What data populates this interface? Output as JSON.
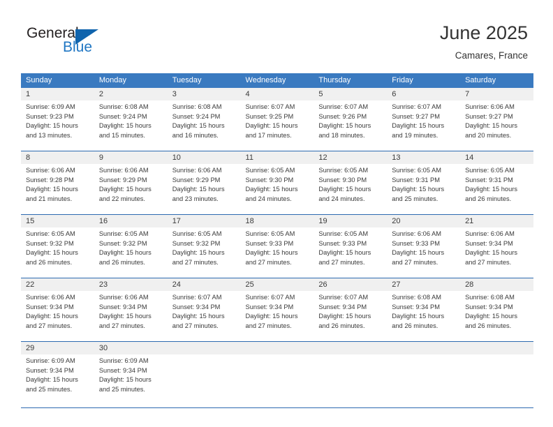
{
  "logo": {
    "word_top": "General",
    "word_bottom": "Blue",
    "triangle_icon": "triangle-icon",
    "brand_color": "#1f76c3",
    "triangle_color": "#1064ad"
  },
  "header": {
    "title": "June 2025",
    "subtitle": "Camares, France"
  },
  "theme": {
    "header_row_bg": "#3a7ac0",
    "header_row_text": "#ffffff",
    "week_divider": "#2d6ab0",
    "day_number_band_bg": "#f0f0f0",
    "text": "#3a3a3a"
  },
  "calendar": {
    "day_headers": [
      "Sunday",
      "Monday",
      "Tuesday",
      "Wednesday",
      "Thursday",
      "Friday",
      "Saturday"
    ],
    "weeks": [
      {
        "days": [
          {
            "num": "1",
            "sunrise": "Sunrise: 6:09 AM",
            "sunset": "Sunset: 9:23 PM",
            "daylight1": "Daylight: 15 hours",
            "daylight2": "and 13 minutes."
          },
          {
            "num": "2",
            "sunrise": "Sunrise: 6:08 AM",
            "sunset": "Sunset: 9:24 PM",
            "daylight1": "Daylight: 15 hours",
            "daylight2": "and 15 minutes."
          },
          {
            "num": "3",
            "sunrise": "Sunrise: 6:08 AM",
            "sunset": "Sunset: 9:24 PM",
            "daylight1": "Daylight: 15 hours",
            "daylight2": "and 16 minutes."
          },
          {
            "num": "4",
            "sunrise": "Sunrise: 6:07 AM",
            "sunset": "Sunset: 9:25 PM",
            "daylight1": "Daylight: 15 hours",
            "daylight2": "and 17 minutes."
          },
          {
            "num": "5",
            "sunrise": "Sunrise: 6:07 AM",
            "sunset": "Sunset: 9:26 PM",
            "daylight1": "Daylight: 15 hours",
            "daylight2": "and 18 minutes."
          },
          {
            "num": "6",
            "sunrise": "Sunrise: 6:07 AM",
            "sunset": "Sunset: 9:27 PM",
            "daylight1": "Daylight: 15 hours",
            "daylight2": "and 19 minutes."
          },
          {
            "num": "7",
            "sunrise": "Sunrise: 6:06 AM",
            "sunset": "Sunset: 9:27 PM",
            "daylight1": "Daylight: 15 hours",
            "daylight2": "and 20 minutes."
          }
        ]
      },
      {
        "days": [
          {
            "num": "8",
            "sunrise": "Sunrise: 6:06 AM",
            "sunset": "Sunset: 9:28 PM",
            "daylight1": "Daylight: 15 hours",
            "daylight2": "and 21 minutes."
          },
          {
            "num": "9",
            "sunrise": "Sunrise: 6:06 AM",
            "sunset": "Sunset: 9:29 PM",
            "daylight1": "Daylight: 15 hours",
            "daylight2": "and 22 minutes."
          },
          {
            "num": "10",
            "sunrise": "Sunrise: 6:06 AM",
            "sunset": "Sunset: 9:29 PM",
            "daylight1": "Daylight: 15 hours",
            "daylight2": "and 23 minutes."
          },
          {
            "num": "11",
            "sunrise": "Sunrise: 6:05 AM",
            "sunset": "Sunset: 9:30 PM",
            "daylight1": "Daylight: 15 hours",
            "daylight2": "and 24 minutes."
          },
          {
            "num": "12",
            "sunrise": "Sunrise: 6:05 AM",
            "sunset": "Sunset: 9:30 PM",
            "daylight1": "Daylight: 15 hours",
            "daylight2": "and 24 minutes."
          },
          {
            "num": "13",
            "sunrise": "Sunrise: 6:05 AM",
            "sunset": "Sunset: 9:31 PM",
            "daylight1": "Daylight: 15 hours",
            "daylight2": "and 25 minutes."
          },
          {
            "num": "14",
            "sunrise": "Sunrise: 6:05 AM",
            "sunset": "Sunset: 9:31 PM",
            "daylight1": "Daylight: 15 hours",
            "daylight2": "and 26 minutes."
          }
        ]
      },
      {
        "days": [
          {
            "num": "15",
            "sunrise": "Sunrise: 6:05 AM",
            "sunset": "Sunset: 9:32 PM",
            "daylight1": "Daylight: 15 hours",
            "daylight2": "and 26 minutes."
          },
          {
            "num": "16",
            "sunrise": "Sunrise: 6:05 AM",
            "sunset": "Sunset: 9:32 PM",
            "daylight1": "Daylight: 15 hours",
            "daylight2": "and 26 minutes."
          },
          {
            "num": "17",
            "sunrise": "Sunrise: 6:05 AM",
            "sunset": "Sunset: 9:32 PM",
            "daylight1": "Daylight: 15 hours",
            "daylight2": "and 27 minutes."
          },
          {
            "num": "18",
            "sunrise": "Sunrise: 6:05 AM",
            "sunset": "Sunset: 9:33 PM",
            "daylight1": "Daylight: 15 hours",
            "daylight2": "and 27 minutes."
          },
          {
            "num": "19",
            "sunrise": "Sunrise: 6:05 AM",
            "sunset": "Sunset: 9:33 PM",
            "daylight1": "Daylight: 15 hours",
            "daylight2": "and 27 minutes."
          },
          {
            "num": "20",
            "sunrise": "Sunrise: 6:06 AM",
            "sunset": "Sunset: 9:33 PM",
            "daylight1": "Daylight: 15 hours",
            "daylight2": "and 27 minutes."
          },
          {
            "num": "21",
            "sunrise": "Sunrise: 6:06 AM",
            "sunset": "Sunset: 9:34 PM",
            "daylight1": "Daylight: 15 hours",
            "daylight2": "and 27 minutes."
          }
        ]
      },
      {
        "days": [
          {
            "num": "22",
            "sunrise": "Sunrise: 6:06 AM",
            "sunset": "Sunset: 9:34 PM",
            "daylight1": "Daylight: 15 hours",
            "daylight2": "and 27 minutes."
          },
          {
            "num": "23",
            "sunrise": "Sunrise: 6:06 AM",
            "sunset": "Sunset: 9:34 PM",
            "daylight1": "Daylight: 15 hours",
            "daylight2": "and 27 minutes."
          },
          {
            "num": "24",
            "sunrise": "Sunrise: 6:07 AM",
            "sunset": "Sunset: 9:34 PM",
            "daylight1": "Daylight: 15 hours",
            "daylight2": "and 27 minutes."
          },
          {
            "num": "25",
            "sunrise": "Sunrise: 6:07 AM",
            "sunset": "Sunset: 9:34 PM",
            "daylight1": "Daylight: 15 hours",
            "daylight2": "and 27 minutes."
          },
          {
            "num": "26",
            "sunrise": "Sunrise: 6:07 AM",
            "sunset": "Sunset: 9:34 PM",
            "daylight1": "Daylight: 15 hours",
            "daylight2": "and 26 minutes."
          },
          {
            "num": "27",
            "sunrise": "Sunrise: 6:08 AM",
            "sunset": "Sunset: 9:34 PM",
            "daylight1": "Daylight: 15 hours",
            "daylight2": "and 26 minutes."
          },
          {
            "num": "28",
            "sunrise": "Sunrise: 6:08 AM",
            "sunset": "Sunset: 9:34 PM",
            "daylight1": "Daylight: 15 hours",
            "daylight2": "and 26 minutes."
          }
        ]
      },
      {
        "days": [
          {
            "num": "29",
            "sunrise": "Sunrise: 6:09 AM",
            "sunset": "Sunset: 9:34 PM",
            "daylight1": "Daylight: 15 hours",
            "daylight2": "and 25 minutes."
          },
          {
            "num": "30",
            "sunrise": "Sunrise: 6:09 AM",
            "sunset": "Sunset: 9:34 PM",
            "daylight1": "Daylight: 15 hours",
            "daylight2": "and 25 minutes."
          },
          {
            "num": "",
            "sunrise": "",
            "sunset": "",
            "daylight1": "",
            "daylight2": ""
          },
          {
            "num": "",
            "sunrise": "",
            "sunset": "",
            "daylight1": "",
            "daylight2": ""
          },
          {
            "num": "",
            "sunrise": "",
            "sunset": "",
            "daylight1": "",
            "daylight2": ""
          },
          {
            "num": "",
            "sunrise": "",
            "sunset": "",
            "daylight1": "",
            "daylight2": ""
          },
          {
            "num": "",
            "sunrise": "",
            "sunset": "",
            "daylight1": "",
            "daylight2": ""
          }
        ]
      }
    ]
  }
}
